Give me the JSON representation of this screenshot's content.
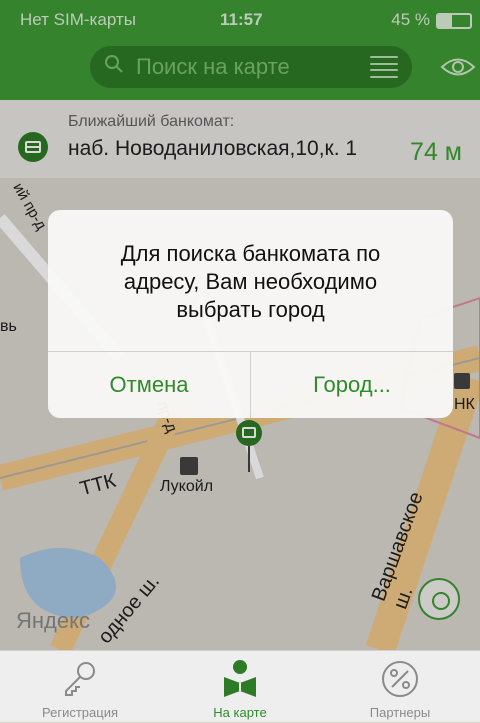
{
  "status": {
    "carrier": "Нет SIM-карты",
    "time": "11:57",
    "battery": "45 %"
  },
  "search": {
    "placeholder": "Поиск на карте"
  },
  "nearest_atm": {
    "label": "Ближайший банкомат:",
    "address": "наб. Новоданиловская,10,к. 1",
    "distance": "74 м"
  },
  "map": {
    "labels": {
      "ttk": "ТТК",
      "lukoil": "Лукойл",
      "varshavskoe": "Варшавское ш.",
      "yandex": "Яндекс",
      "prd": "пр-д",
      "vb": "вь",
      "nk": "НК",
      "wii": "ий пр-д",
      "odnoe": "одное ш."
    }
  },
  "dialog": {
    "message": "Для поиска банкомата по\nадресу, Вам необходимо\nвыбрать город",
    "cancel": "Отмена",
    "city": "Город..."
  },
  "tabs": [
    {
      "label": "Регистрация",
      "icon": "key-icon"
    },
    {
      "label": "На карте",
      "icon": "map-reader-icon"
    },
    {
      "label": "Партнеры",
      "icon": "percent-icon"
    }
  ],
  "colors": {
    "brand_green": "#3f9a35",
    "dark_green": "#2e7b26",
    "accent_text": "#2e8b2a"
  }
}
